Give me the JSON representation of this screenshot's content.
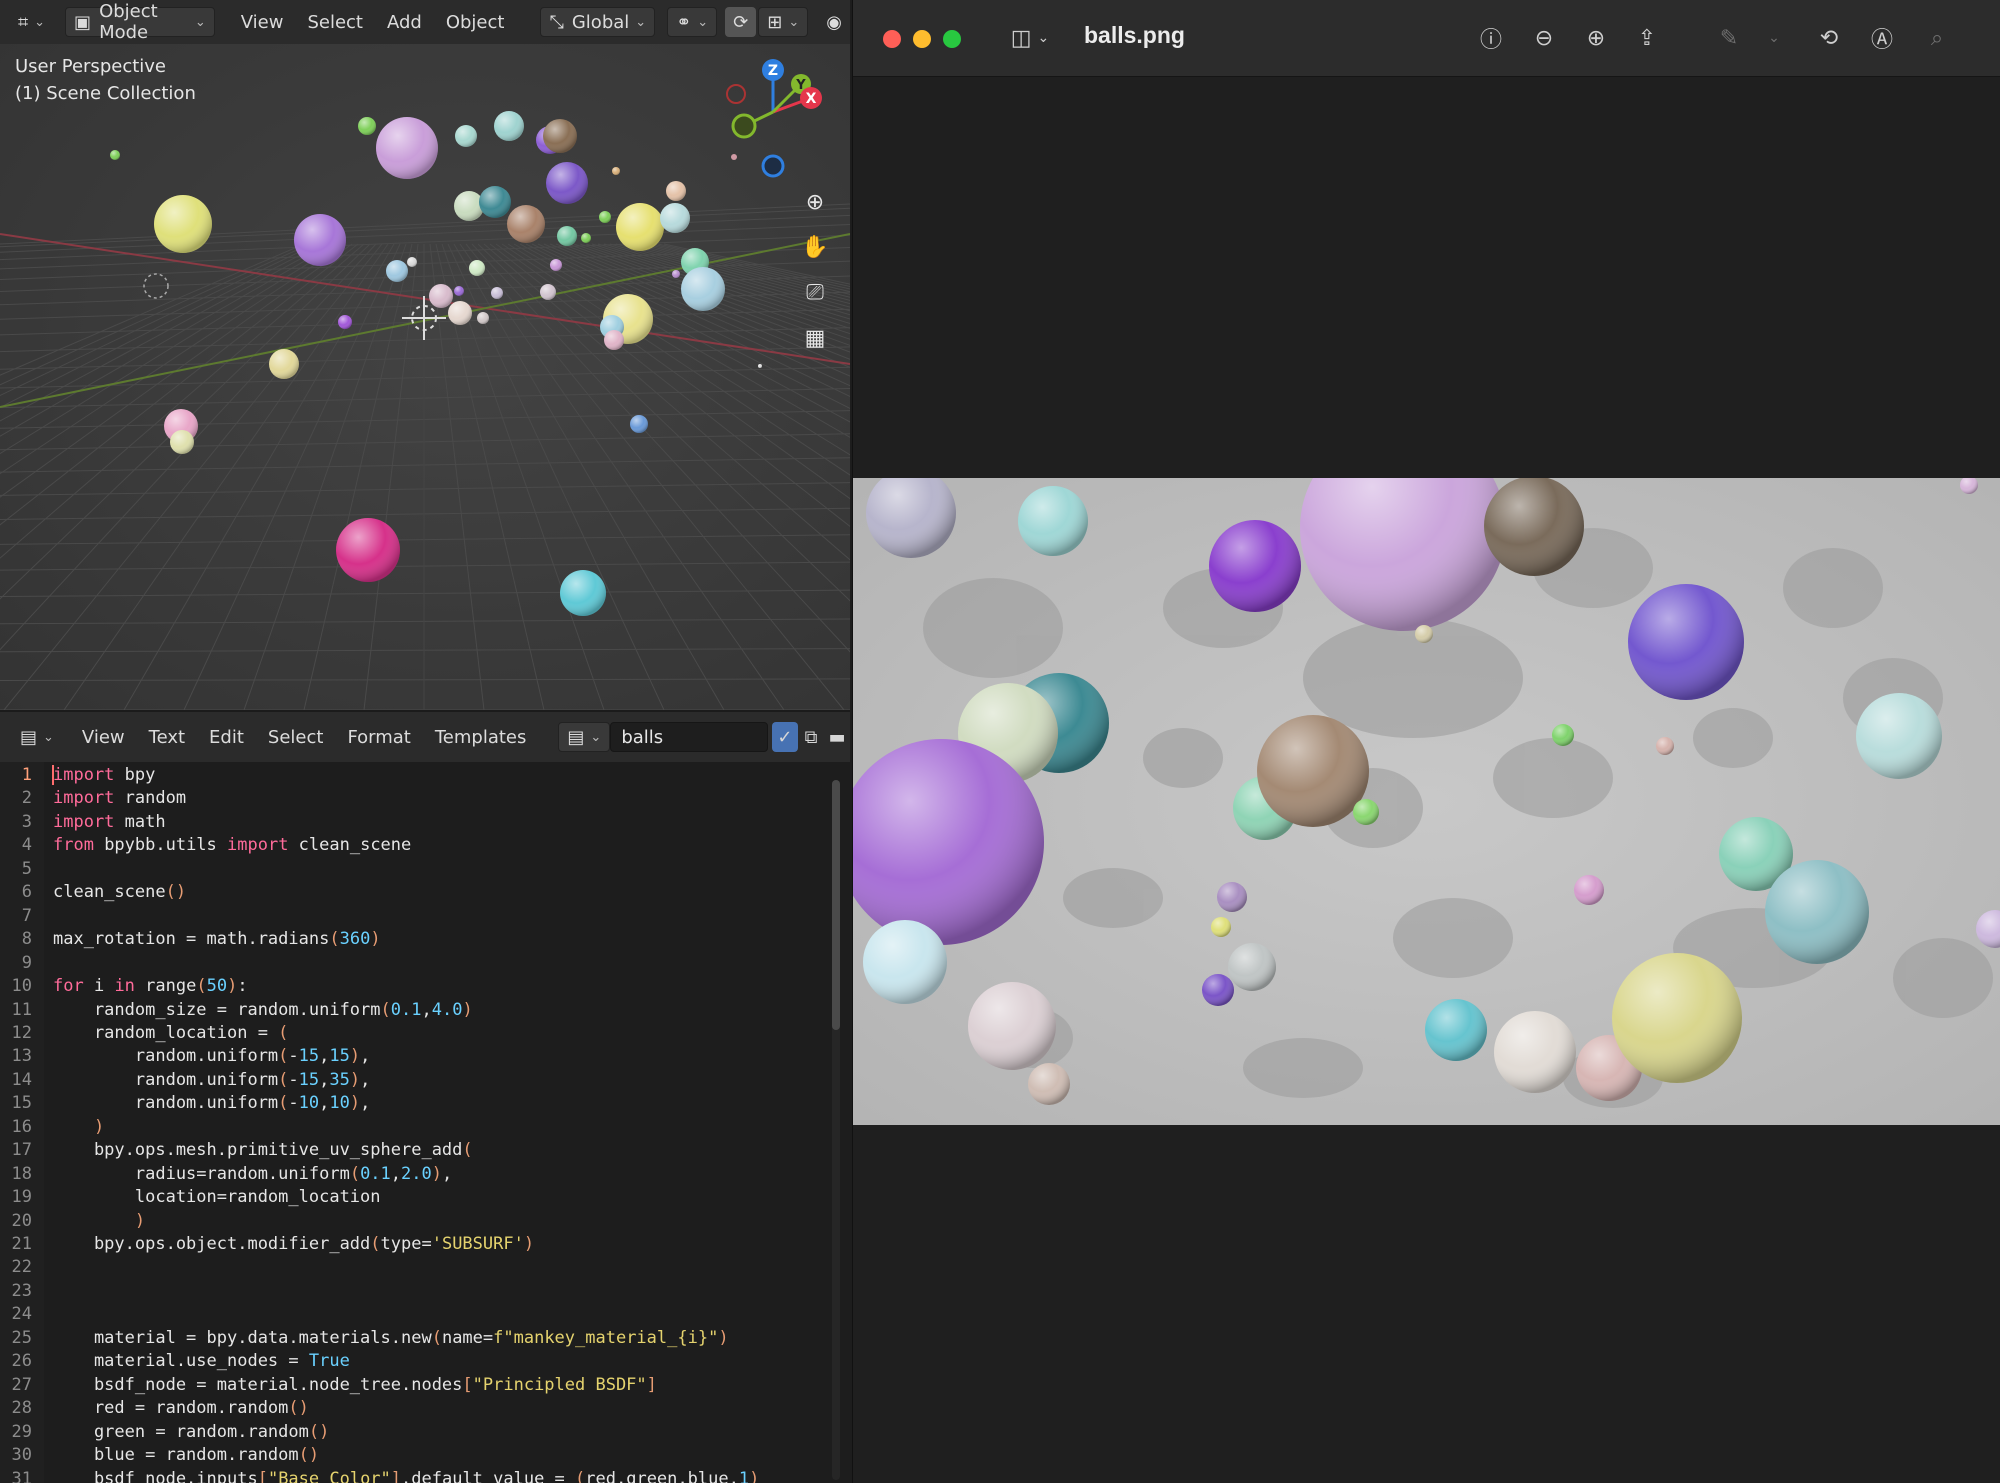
{
  "blender": {
    "viewport_header": {
      "mode": "Object Mode",
      "menus": [
        "View",
        "Select",
        "Add",
        "Object"
      ],
      "orientation": "Global"
    },
    "viewport": {
      "perspective_label": "User Perspective",
      "collection_label": "(1) Scene Collection",
      "gizmo_axes": {
        "z": "Z",
        "y": "Y",
        "x": "X"
      },
      "nav_icons": [
        "zoom-icon",
        "hand-pan-icon",
        "camera-icon",
        "grid-icon"
      ]
    },
    "text_editor_header": {
      "menus": [
        "View",
        "Text",
        "Edit",
        "Select",
        "Format",
        "Templates"
      ],
      "text_name": "balls"
    },
    "code": [
      "import bpy",
      "import random",
      "import math",
      "from bpybb.utils import clean_scene",
      "",
      "clean_scene()",
      "",
      "max_rotation = math.radians(360)",
      "",
      "for i in range(50):",
      "    random_size = random.uniform(0.1,4.0)",
      "    random_location = (",
      "        random.uniform(-15,15),",
      "        random.uniform(-15,35),",
      "        random.uniform(-10,10),",
      "    )",
      "    bpy.ops.mesh.primitive_uv_sphere_add(",
      "        radius=random.uniform(0.1,2.0),",
      "        location=random_location",
      "        )",
      "    bpy.ops.object.modifier_add(type='SUBSURF')",
      "",
      "",
      "",
      "    material = bpy.data.materials.new(name=f\"mankey_material_{i}\")",
      "    material.use_nodes = True",
      "    bsdf_node = material.node_tree.nodes[\"Principled BSDF\"]",
      "    red = random.random()",
      "    green = random.random()",
      "    blue = random.random()",
      "    bsdf_node.inputs[\"Base Color\"].default_value = (red,green,blue,1)"
    ],
    "line_numbers": [
      "1",
      "2",
      "3",
      "4",
      "5",
      "6",
      "7",
      "8",
      "9",
      "10",
      "11",
      "12",
      "13",
      "14",
      "15",
      "16",
      "17",
      "18",
      "19",
      "20",
      "21",
      "22",
      "23",
      "24",
      "25",
      "26",
      "27",
      "28",
      "29",
      "30",
      "31"
    ]
  },
  "preview": {
    "title": "balls.png",
    "toolbar_icons": [
      "sidebar-icon",
      "info-icon",
      "zoom-out-icon",
      "zoom-in-icon",
      "share-icon",
      "markup-pen-icon",
      "rotate-icon",
      "annotate-icon",
      "search-icon"
    ]
  },
  "colors": {
    "blender_bg": "#303030",
    "code_keyword": "#ff6b9a",
    "code_number": "#6ad1ff",
    "code_string": "#e5d36e",
    "axis_x": "#e5364b",
    "axis_y": "#83b82d",
    "axis_z": "#2f7fe0"
  }
}
